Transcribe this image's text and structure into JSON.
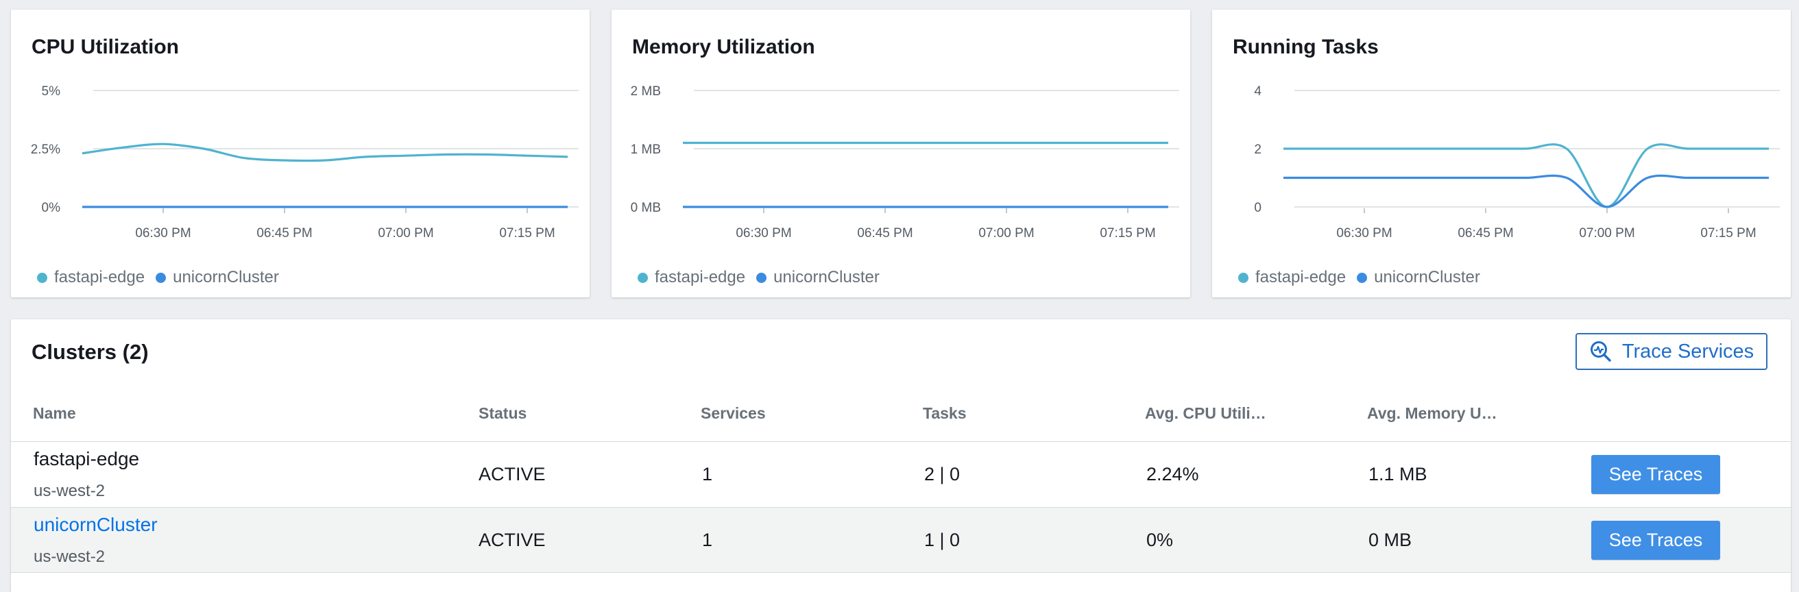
{
  "colors": {
    "fastapi": "#4fb3cf",
    "unicorn": "#3b8be0",
    "link": "#0073e6",
    "button": "#3f8fe6"
  },
  "charts": [
    {
      "title": "CPU Utilization",
      "chart_data": {
        "type": "line",
        "title": "CPU Utilization",
        "x": [
          "06:20 PM",
          "06:25 PM",
          "06:30 PM",
          "06:35 PM",
          "06:40 PM",
          "06:45 PM",
          "06:50 PM",
          "06:55 PM",
          "07:00 PM",
          "07:05 PM",
          "07:10 PM",
          "07:15 PM",
          "07:20 PM"
        ],
        "x_ticks": [
          "06:30 PM",
          "06:45 PM",
          "07:00 PM",
          "07:15 PM"
        ],
        "y_ticks": [
          "0%",
          "2.5%",
          "5%"
        ],
        "ylim": [
          0,
          5
        ],
        "series": [
          {
            "name": "fastapi-edge",
            "values": [
              2.3,
              2.55,
              2.7,
              2.5,
              2.1,
              2.0,
              2.0,
              2.15,
              2.2,
              2.25,
              2.25,
              2.2,
              2.15
            ]
          },
          {
            "name": "unicornCluster",
            "values": [
              0,
              0,
              0,
              0,
              0,
              0,
              0,
              0,
              0,
              0,
              0,
              0,
              0
            ]
          }
        ]
      }
    },
    {
      "title": "Memory Utilization",
      "chart_data": {
        "type": "line",
        "title": "Memory Utilization",
        "x": [
          "06:20 PM",
          "06:25 PM",
          "06:30 PM",
          "06:35 PM",
          "06:40 PM",
          "06:45 PM",
          "06:50 PM",
          "06:55 PM",
          "07:00 PM",
          "07:05 PM",
          "07:10 PM",
          "07:15 PM",
          "07:20 PM"
        ],
        "x_ticks": [
          "06:30 PM",
          "06:45 PM",
          "07:00 PM",
          "07:15 PM"
        ],
        "y_ticks": [
          "0 MB",
          "1 MB",
          "2 MB"
        ],
        "ylim": [
          0,
          2
        ],
        "series": [
          {
            "name": "fastapi-edge",
            "values": [
              1.1,
              1.1,
              1.1,
              1.1,
              1.1,
              1.1,
              1.1,
              1.1,
              1.1,
              1.1,
              1.1,
              1.1,
              1.1
            ]
          },
          {
            "name": "unicornCluster",
            "values": [
              0,
              0,
              0,
              0,
              0,
              0,
              0,
              0,
              0,
              0,
              0,
              0,
              0
            ]
          }
        ]
      }
    },
    {
      "title": "Running Tasks",
      "chart_data": {
        "type": "line",
        "title": "Running Tasks",
        "x": [
          "06:20 PM",
          "06:25 PM",
          "06:30 PM",
          "06:35 PM",
          "06:40 PM",
          "06:45 PM",
          "06:50 PM",
          "06:55 PM",
          "07:00 PM",
          "07:05 PM",
          "07:10 PM",
          "07:15 PM",
          "07:20 PM"
        ],
        "x_ticks": [
          "06:30 PM",
          "06:45 PM",
          "07:00 PM",
          "07:15 PM"
        ],
        "y_ticks": [
          "0",
          "2",
          "4"
        ],
        "ylim": [
          0,
          4
        ],
        "series": [
          {
            "name": "fastapi-edge",
            "values": [
              2,
              2,
              2,
              2,
              2,
              2,
              2,
              2,
              0,
              2,
              2,
              2,
              2
            ]
          },
          {
            "name": "unicornCluster",
            "values": [
              1,
              1,
              1,
              1,
              1,
              1,
              1,
              1,
              0,
              1,
              1,
              1,
              1
            ]
          }
        ]
      }
    }
  ],
  "clusters": {
    "title": "Clusters (2)",
    "trace_button": "Trace Services",
    "columns": [
      "Name",
      "Status",
      "Services",
      "Tasks",
      "Avg. CPU Utili…",
      "Avg. Memory U…"
    ],
    "rows": [
      {
        "name": "fastapi-edge",
        "region": "us-west-2",
        "status": "ACTIVE",
        "services": "1",
        "tasks": "2 | 0",
        "cpu": "2.24%",
        "memory": "1.1 MB",
        "action": "See Traces"
      },
      {
        "name": "unicornCluster",
        "region": "us-west-2",
        "status": "ACTIVE",
        "services": "1",
        "tasks": "1 | 0",
        "cpu": "0%",
        "memory": "0 MB",
        "action": "See Traces"
      }
    ]
  }
}
